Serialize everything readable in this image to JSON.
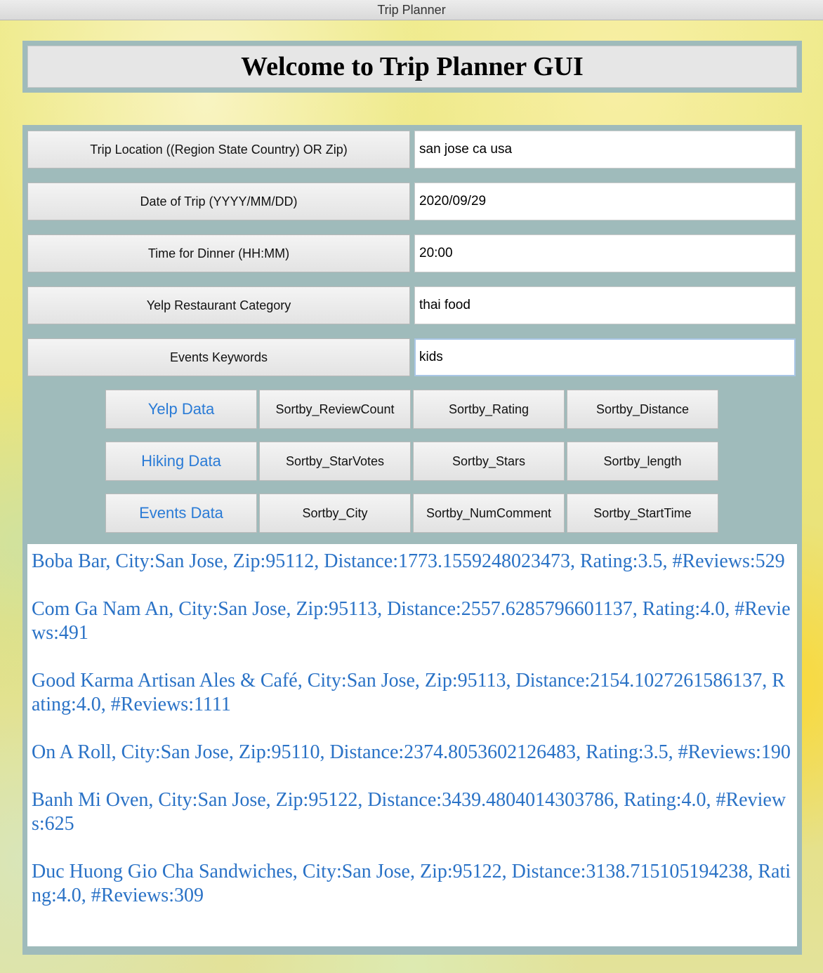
{
  "window": {
    "title": "Trip Planner"
  },
  "header": {
    "title": "Welcome to Trip Planner GUI"
  },
  "form": {
    "rows": [
      {
        "label": "Trip Location ((Region State Country) OR Zip)",
        "value": "san jose ca usa"
      },
      {
        "label": "Date of Trip (YYYY/MM/DD)",
        "value": "2020/09/29"
      },
      {
        "label": "Time for Dinner (HH:MM)",
        "value": "20:00"
      },
      {
        "label": "Yelp Restaurant Category",
        "value": "thai food"
      },
      {
        "label": "Events Keywords",
        "value": "kids"
      }
    ]
  },
  "buttons": {
    "yelp": {
      "main": "Yelp Data",
      "sort1": "Sortby_ReviewCount",
      "sort2": "Sortby_Rating",
      "sort3": "Sortby_Distance"
    },
    "hiking": {
      "main": "Hiking Data",
      "sort1": "Sortby_StarVotes",
      "sort2": "Sortby_Stars",
      "sort3": "Sortby_length"
    },
    "events": {
      "main": "Events Data",
      "sort1": "Sortby_City",
      "sort2": "Sortby_NumComment",
      "sort3": "Sortby_StartTime"
    }
  },
  "results": [
    "Boba Bar, City:San Jose, Zip:95112, Distance:1773.1559248023473, Rating:3.5, #Reviews:529",
    "Com Ga Nam An, City:San Jose, Zip:95113, Distance:2557.6285796601137, Rating:4.0, #Reviews:491",
    "Good Karma Artisan Ales & Café, City:San Jose, Zip:95113, Distance:2154.1027261586137, Rating:4.0, #Reviews:1111",
    "On A Roll, City:San Jose, Zip:95110, Distance:2374.8053602126483, Rating:3.5, #Reviews:190",
    "Banh Mi Oven, City:San Jose, Zip:95122, Distance:3439.4804014303786, Rating:4.0, #Reviews:625",
    "Duc Huong Gio Cha Sandwiches, City:San Jose, Zip:95122, Distance:3138.715105194238, Rating:4.0, #Reviews:309"
  ],
  "colors": {
    "frame": "#9fbbbb",
    "link_text": "#2a72c6",
    "primary_button_text": "#2a7bd6"
  }
}
